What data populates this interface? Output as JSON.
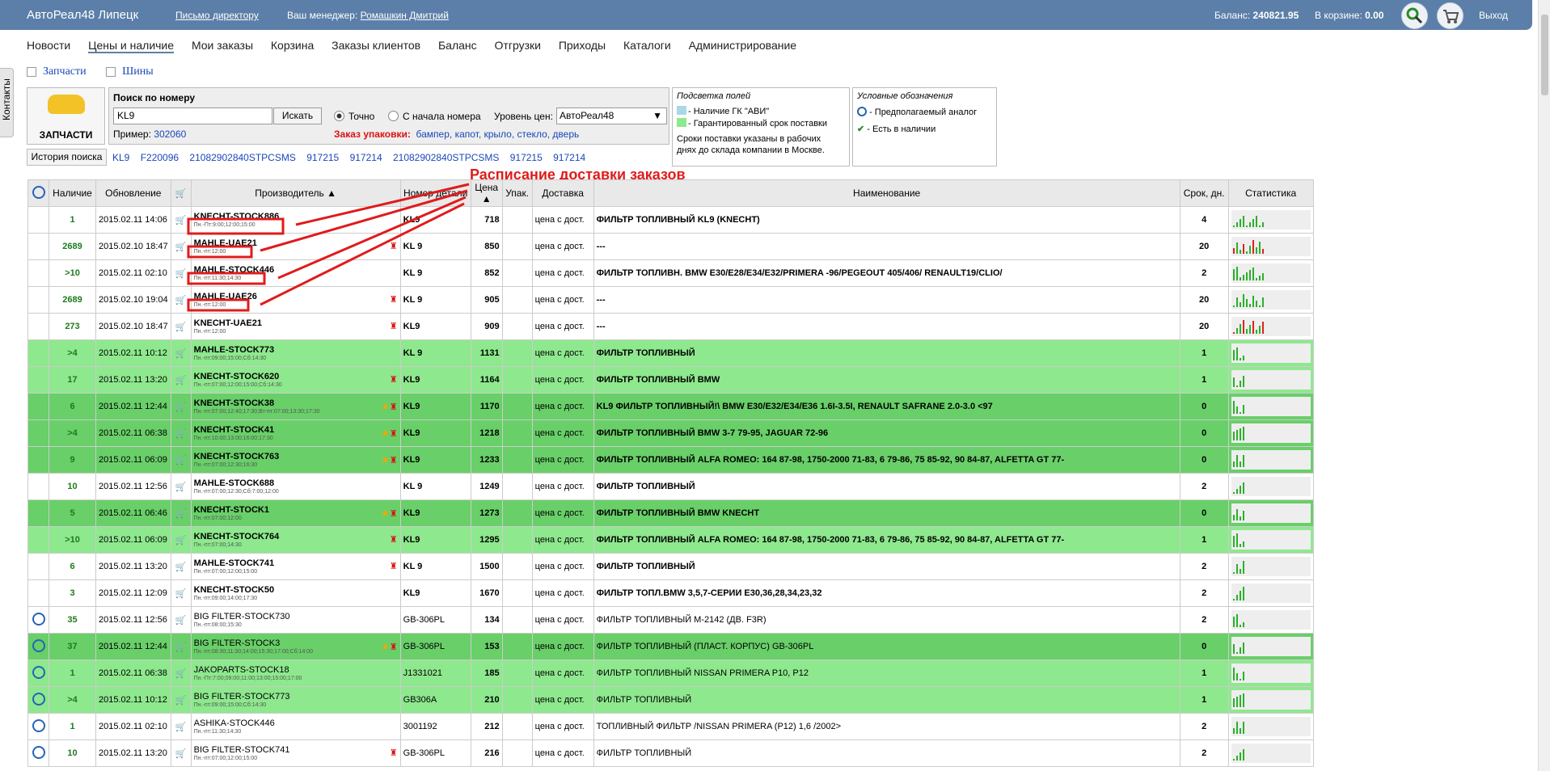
{
  "header": {
    "brand": "АвтоРеал48 Липецк",
    "director_letter": "Письмо директору",
    "manager_label": "Ваш менеджер:",
    "manager_name": "Ромашкин Дмитрий",
    "balance_label": "Баланс:",
    "balance_value": "240821.95",
    "cart_label": "В корзине:",
    "cart_value": "0.00",
    "exit": "Выход"
  },
  "nav": [
    "Новости",
    "Цены и наличие",
    "Мои заказы",
    "Корзина",
    "Заказы клиентов",
    "Баланс",
    "Отгрузки",
    "Приходы",
    "Каталоги",
    "Администрирование"
  ],
  "contacts_tab": "Контакты",
  "category_tabs": [
    "Запчасти",
    "Шины"
  ],
  "big_button": "ЗАПЧАСТИ",
  "search": {
    "title": "Поиск по номеру",
    "value": "KL9",
    "button": "Искать",
    "radio_exact": "Точно",
    "radio_start": "С начала номера",
    "price_level_label": "Уровень цен:",
    "price_level_value": "АвтоРеал48",
    "example_label": "Пример:",
    "example_value": "302060",
    "package_label": "Заказ упаковки:",
    "package_items": "бампер, капот, крыло, стекло, дверь"
  },
  "history": {
    "button": "История поиска",
    "items": [
      "KL9",
      "F220096",
      "21082902840STPCSMS",
      "917215",
      "917214",
      "21082902840STPCSMS",
      "917215",
      "917214"
    ]
  },
  "legend_fields": {
    "title": "Подсветка полей",
    "item1": "- Наличие ГК \"АВИ\"",
    "item2": "- Гарантированный срок поставки",
    "note1": "Сроки поставки указаны в рабочих",
    "note2": "днях до склада компании в Москве."
  },
  "legend_symbols": {
    "title": "Условные обозначения",
    "item1": "- Предполагаемый аналог",
    "item2": "- Есть в наличии"
  },
  "annotation": "Расписание доставки заказов",
  "table": {
    "headers": {
      "stock": "Наличие",
      "updated": "Обновление",
      "manufacturer": "Производитель",
      "number": "Номер детали",
      "price": "Цена",
      "pack": "Упак.",
      "delivery": "Доставка",
      "name": "Наименование",
      "term": "Срок, дн.",
      "stats": "Статистика"
    },
    "rows": [
      {
        "qty": "1",
        "date": "2015.02.11 14:06",
        "mfr": "KNECHT-STOCK886",
        "sched": "Пн.-Пт:9:00;12:00;15:00",
        "num": "KL9",
        "price": "718",
        "del": "цена с дост.",
        "name": "ФИЛЬТР ТОПЛИВНЫЙ KL9 (KNECHT)",
        "term": "4",
        "style": "white",
        "bold": true,
        "refresh": false,
        "star": false,
        "fig": false
      },
      {
        "qty": "2689",
        "date": "2015.02.10 18:47",
        "mfr": "MAHLE-UAE21",
        "sched": "Пн.-пт:12:00",
        "num": "KL 9",
        "price": "850",
        "del": "цена с дост.",
        "name": "---",
        "term": "20",
        "style": "white",
        "bold": true,
        "refresh": false,
        "star": false,
        "fig": true
      },
      {
        "qty": ">10",
        "date": "2015.02.11 02:10",
        "mfr": "MAHLE-STOCK446",
        "sched": "Пн.-пт:11:30;14:30",
        "num": "KL 9",
        "price": "852",
        "del": "цена с дост.",
        "name": "ФИЛЬТР ТОПЛИВН. BMW E30/E28/E34/E32/PRIMERA -96/PEGEOUT 405/406/ RENAULT19/CLIO/",
        "term": "2",
        "style": "white",
        "bold": true,
        "refresh": false,
        "star": false,
        "fig": false
      },
      {
        "qty": "2689",
        "date": "2015.02.10 19:04",
        "mfr": "MAHLE-UAE26",
        "sched": "Пн.-пт:12:00",
        "num": "KL 9",
        "price": "905",
        "del": "цена с дост.",
        "name": "---",
        "term": "20",
        "style": "white",
        "bold": true,
        "refresh": false,
        "star": false,
        "fig": true
      },
      {
        "qty": "273",
        "date": "2015.02.10 18:47",
        "mfr": "KNECHT-UAE21",
        "sched": "Пн.-пт:12:00",
        "num": "KL9",
        "price": "909",
        "del": "цена с дост.",
        "name": "---",
        "term": "20",
        "style": "white",
        "bold": true,
        "refresh": false,
        "star": false,
        "fig": true
      },
      {
        "qty": ">4",
        "date": "2015.02.11 10:12",
        "mfr": "MAHLE-STOCK773",
        "sched": "Пн.-пт:09:00;15:00;Сб:14:30",
        "num": "KL 9",
        "price": "1131",
        "del": "цена с дост.",
        "name": "ФИЛЬТР ТОПЛИВНЫЙ",
        "term": "1",
        "style": "light",
        "bold": true,
        "refresh": false,
        "star": false,
        "fig": false
      },
      {
        "qty": "17",
        "date": "2015.02.11 13:20",
        "mfr": "KNECHT-STOCK620",
        "sched": "Пн.-пт:07:00;12:00;15:00;Сб:14:30",
        "num": "KL9",
        "price": "1164",
        "del": "цена с дост.",
        "name": "ФИЛЬТР ТОПЛИВНЫЙ BMW",
        "term": "1",
        "style": "light",
        "bold": true,
        "refresh": false,
        "star": false,
        "fig": true
      },
      {
        "qty": "6",
        "date": "2015.02.11 12:44",
        "mfr": "KNECHT-STOCK38",
        "sched": "Пн.-пт:07:00;12:40;17:30;Вт-пт:07:00;13:30;17:30",
        "num": "KL9",
        "price": "1170",
        "del": "цена с дост.",
        "name": "KL9 ФИЛЬТР ТОПЛИВНЫЙ!\\ BMW E30/E32/E34/E36 1.6I-3.5I, RENAULT SAFRANE 2.0-3.0 <97",
        "term": "0",
        "style": "dark",
        "bold": true,
        "refresh": false,
        "star": true,
        "fig": true
      },
      {
        "qty": ">4",
        "date": "2015.02.11 06:38",
        "mfr": "KNECHT-STOCK41",
        "sched": "Пн.-пт:10:00;13:00;16:00;17:30",
        "num": "KL9",
        "price": "1218",
        "del": "цена с дост.",
        "name": "ФИЛЬТР ТОПЛИВНЫЙ BMW 3-7 79-95, JAGUAR 72-96",
        "term": "0",
        "style": "dark",
        "bold": true,
        "refresh": false,
        "star": true,
        "fig": true
      },
      {
        "qty": "9",
        "date": "2015.02.11 06:09",
        "mfr": "KNECHT-STOCK763",
        "sched": "Пн.-пт:07:00;12:30;16:30",
        "num": "KL9",
        "price": "1233",
        "del": "цена с дост.",
        "name": "ФИЛЬТР ТОПЛИВНЫЙ ALFA ROMEO: 164 87-98, 1750-2000 71-83, 6 79-86, 75 85-92, 90 84-87, ALFETTA GT 77-",
        "term": "0",
        "style": "dark",
        "bold": true,
        "refresh": false,
        "star": true,
        "fig": true
      },
      {
        "qty": "10",
        "date": "2015.02.11 12:56",
        "mfr": "MAHLE-STOCK688",
        "sched": "Пн.-пт:07:00;12:30;Сб:7:00;12:00",
        "num": "KL 9",
        "price": "1249",
        "del": "цена с дост.",
        "name": "ФИЛЬТР ТОПЛИВНЫЙ",
        "term": "2",
        "style": "white",
        "bold": true,
        "refresh": false,
        "star": false,
        "fig": false
      },
      {
        "qty": "5",
        "date": "2015.02.11 06:46",
        "mfr": "KNECHT-STOCK1",
        "sched": "Пн.-пт:07:00;12:00",
        "num": "KL9",
        "price": "1273",
        "del": "цена с дост.",
        "name": "ФИЛЬТР ТОПЛИВНЫЙ BMW KNECHT",
        "term": "0",
        "style": "dark",
        "bold": true,
        "refresh": false,
        "star": true,
        "fig": true
      },
      {
        "qty": ">10",
        "date": "2015.02.11 06:09",
        "mfr": "KNECHT-STOCK764",
        "sched": "Пн.-пт:07:00;14:30",
        "num": "KL9",
        "price": "1295",
        "del": "цена с дост.",
        "name": "ФИЛЬТР ТОПЛИВНЫЙ ALFA ROMEO: 164 87-98, 1750-2000 71-83, 6 79-86, 75 85-92, 90 84-87, ALFETTA GT 77-",
        "term": "1",
        "style": "light",
        "bold": true,
        "refresh": false,
        "star": false,
        "fig": true
      },
      {
        "qty": "6",
        "date": "2015.02.11 13:20",
        "mfr": "MAHLE-STOCK741",
        "sched": "Пн.-пт:07:00;12:00;15:00",
        "num": "KL 9",
        "price": "1500",
        "del": "цена с дост.",
        "name": "ФИЛЬТР ТОПЛИВНЫЙ",
        "term": "2",
        "style": "white",
        "bold": true,
        "refresh": false,
        "star": false,
        "fig": true
      },
      {
        "qty": "3",
        "date": "2015.02.11 12:09",
        "mfr": "KNECHT-STOCK50",
        "sched": "Пн.-пт:09:00;14:00;17:30",
        "num": "KL9",
        "price": "1670",
        "del": "цена с дост.",
        "name": "ФИЛЬТР ТОПЛ.BMW 3,5,7-СЕРИИ E30,36,28,34,23,32",
        "term": "2",
        "style": "white",
        "bold": true,
        "refresh": false,
        "star": false,
        "fig": false
      },
      {
        "qty": "35",
        "date": "2015.02.11 12:56",
        "mfr": "BIG FILTER-STOCK730",
        "sched": "Пн.-пт:08:00;15:30",
        "num": "GB-306PL",
        "price": "134",
        "del": "цена с дост.",
        "name": "ФИЛЬТР ТОПЛИВНЫЙ М-2142 (ДВ. F3R)",
        "term": "2",
        "style": "white",
        "bold": false,
        "refresh": true,
        "star": false,
        "fig": false
      },
      {
        "qty": "37",
        "date": "2015.02.11 12:44",
        "mfr": "BIG FILTER-STOCK3",
        "sched": "Пн.-пт:08:30;11:30;14:00;15:30;17:00;Сб:14:00",
        "num": "GB-306PL",
        "price": "153",
        "del": "цена с дост.",
        "name": "ФИЛЬТР ТОПЛИВНЫЙ (ПЛАСТ. КОРПУС) GB-306PL",
        "term": "0",
        "style": "dark",
        "bold": false,
        "refresh": true,
        "star": true,
        "fig": true
      },
      {
        "qty": "1",
        "date": "2015.02.11 06:38",
        "mfr": "JAKOPARTS-STOCK18",
        "sched": "Пн.-Пт:7:00;09:00;11:00;13:00;15:00;17:00",
        "num": "J1331021",
        "price": "185",
        "del": "цена с дост.",
        "name": "ФИЛЬТР ТОПЛИВНЫЙ NISSAN PRIMERA P10, P12",
        "term": "1",
        "style": "light",
        "bold": false,
        "refresh": true,
        "star": false,
        "fig": false
      },
      {
        "qty": ">4",
        "date": "2015.02.11 10:12",
        "mfr": "BIG FILTER-STOCK773",
        "sched": "Пн.-пт:09:00;15:00;Сб:14:30",
        "num": "GB306A",
        "price": "210",
        "del": "цена с дост.",
        "name": "ФИЛЬТР ТОПЛИВНЫЙ",
        "term": "1",
        "style": "light",
        "bold": false,
        "refresh": true,
        "star": false,
        "fig": false
      },
      {
        "qty": "1",
        "date": "2015.02.11 02:10",
        "mfr": "ASHIKA-STOCK446",
        "sched": "Пн.-пт:11:30;14:30",
        "num": "3001192",
        "price": "212",
        "del": "цена с дост.",
        "name": "ТОПЛИВНЫЙ ФИЛЬТР /NISSAN PRIMERA (P12) 1,6 /2002>",
        "term": "2",
        "style": "white",
        "bold": false,
        "refresh": true,
        "star": false,
        "fig": false
      },
      {
        "qty": "10",
        "date": "2015.02.11 13:20",
        "mfr": "BIG FILTER-STOCK741",
        "sched": "Пн.-пт:07:00;12:00;15:00",
        "num": "GB-306PL",
        "price": "216",
        "del": "цена с дост.",
        "name": "ФИЛЬТР ТОПЛИВНЫЙ",
        "term": "2",
        "style": "white",
        "bold": false,
        "refresh": true,
        "star": false,
        "fig": true
      }
    ]
  },
  "colors": {
    "header": "#5b7fa8",
    "row_light": "#8ee88e",
    "row_dark": "#69cf69",
    "annotation": "#e01b1b"
  }
}
